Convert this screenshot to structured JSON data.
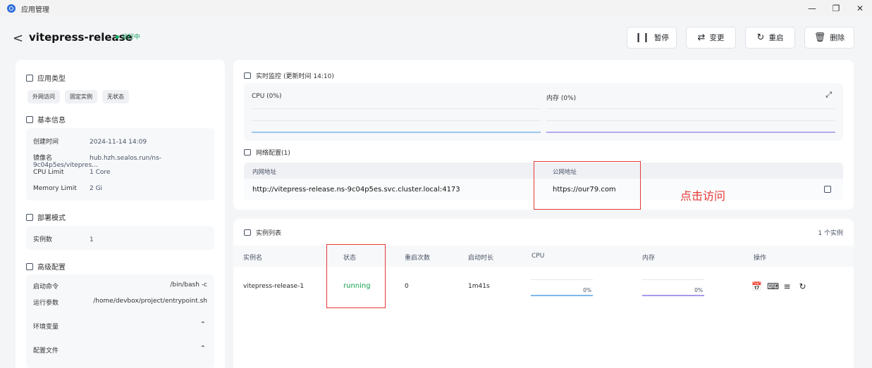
{
  "window": {
    "title": "应用管理",
    "controls": [
      "—",
      "❐",
      "✕"
    ]
  },
  "header": {
    "back": "<",
    "app_name": "vitepress-release",
    "status": "运行中",
    "actions": {
      "pause": "暂停",
      "change": "变更",
      "restart": "重启",
      "delete": "删除"
    }
  },
  "left": {
    "app_type_title": "应用类型",
    "tags": [
      "外网访问",
      "固定实例",
      "无状态"
    ],
    "basic_title": "基本信息",
    "basic": [
      {
        "k": "创建时间",
        "v": "2024-11-14 14:09"
      },
      {
        "k": "镜像名",
        "v": "hub.hzh.sealos.run/ns-9c04p5es/vitepres..."
      },
      {
        "k": "CPU Limit",
        "v": "1 Core"
      },
      {
        "k": "Memory Limit",
        "v": "2 Gi"
      }
    ],
    "deploy_title": "部署模式",
    "deploy": {
      "k": "实例数",
      "v": "1"
    },
    "advanced_title": "高级配置",
    "advanced": [
      {
        "k": "启动命令",
        "v": "/bin/bash -c"
      },
      {
        "k": "运行参数",
        "v": "/home/devbox/project/entrypoint.sh"
      }
    ],
    "env_label": "环境变量",
    "config_label": "配置文件"
  },
  "monitor": {
    "title": "实时监控",
    "updated": "(更新时间 14:10)",
    "cpu_label": "CPU  (0%)",
    "mem_label": "内存  (0%)",
    "cpu_line_color": "#9cc6f0",
    "mem_line_color": "#b6a9ef"
  },
  "network": {
    "title": "网络配置(1)",
    "internal_label": "内网地址",
    "public_label": "公网地址",
    "internal": "http://vitepress-release.ns-9c04p5es.svc.cluster.local:4173",
    "public": "https://our79.com",
    "annotation": "点击访问"
  },
  "instances": {
    "title": "实例列表",
    "count": "1 个实例",
    "columns": [
      "实例名",
      "状态",
      "重启次数",
      "启动时长",
      "CPU",
      "内存",
      "操作"
    ],
    "rows": [
      {
        "name": "vitepress-release-1",
        "status": "running",
        "restarts": "0",
        "uptime": "1m41s",
        "cpu": "0%",
        "mem": "0%"
      }
    ],
    "ops": [
      "calendar-icon",
      "terminal-icon",
      "log-icon",
      "restart-icon"
    ]
  },
  "colors": {
    "accent_red": "#e53935",
    "running_green": "#12a150"
  }
}
